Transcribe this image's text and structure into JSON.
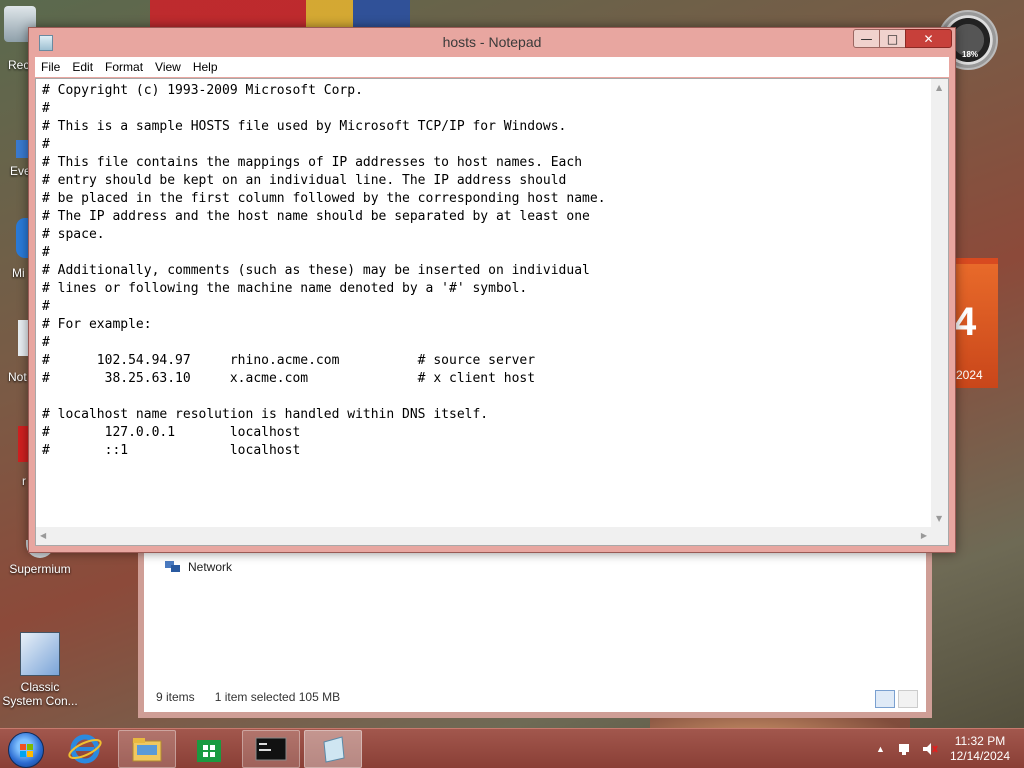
{
  "desktop": {
    "icons": [
      {
        "label": "Rec"
      },
      {
        "label": "Eve"
      },
      {
        "label": "Mi"
      },
      {
        "label": "Not"
      },
      {
        "label": "r"
      },
      {
        "label": "Supermium"
      },
      {
        "label": "Classic System Con..."
      }
    ],
    "gauge_value": "18%",
    "calendar": {
      "day": "4",
      "year": "2024"
    }
  },
  "notepad": {
    "title": "hosts - Notepad",
    "menu": [
      "File",
      "Edit",
      "Format",
      "View",
      "Help"
    ],
    "lines": [
      "# Copyright (c) 1993-2009 Microsoft Corp.",
      "#",
      "# This is a sample HOSTS file used by Microsoft TCP/IP for Windows.",
      "#",
      "# This file contains the mappings of IP addresses to host names. Each",
      "# entry should be kept on an individual line. The IP address should",
      "# be placed in the first column followed by the corresponding host name.",
      "# The IP address and the host name should be separated by at least one",
      "# space.",
      "#",
      "# Additionally, comments (such as these) may be inserted on individual",
      "# lines or following the machine name denoted by a '#' symbol.",
      "#",
      "# For example:",
      "#",
      "#      102.54.94.97     rhino.acme.com          # source server",
      "#       38.25.63.10     x.acme.com              # x client host",
      "",
      "# localhost name resolution is handled within DNS itself.",
      "#       127.0.0.1       localhost",
      "#       ::1             localhost"
    ]
  },
  "explorer": {
    "network_label": "Network",
    "status_items": "9 items",
    "status_selected": "1 item selected  105 MB"
  },
  "taskbar": {
    "time": "11:32 PM",
    "date": "12/14/2024"
  }
}
